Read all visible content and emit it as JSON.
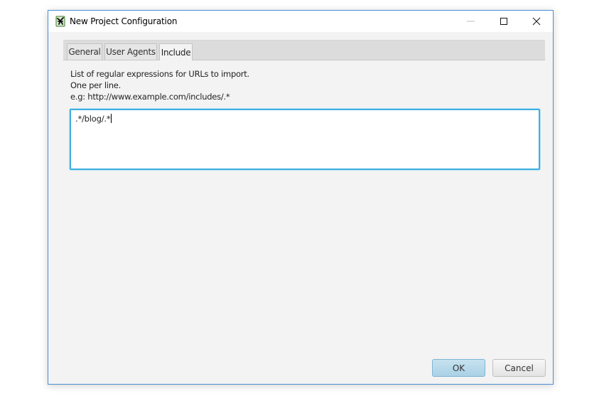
{
  "window": {
    "title": "New Project Configuration",
    "app_icon": "app-logo-icon",
    "controls": {
      "minimize": "minimize-icon",
      "maximize": "maximize-icon",
      "close": "close-icon"
    }
  },
  "tabs": [
    {
      "label": "General",
      "active": false
    },
    {
      "label": "User Agents",
      "active": false
    },
    {
      "label": "Include",
      "active": true
    }
  ],
  "include": {
    "description_lines": [
      "List of regular expressions for URLs to import.",
      "One per line.",
      "e.g: http://www.example.com/includes/.*"
    ],
    "textarea_value": ".*/blog/.*"
  },
  "buttons": {
    "ok": "OK",
    "cancel": "Cancel"
  },
  "colors": {
    "focus_border": "#3fb0e0",
    "default_button": "#b9daeb",
    "window_border": "#4a8fd0"
  }
}
